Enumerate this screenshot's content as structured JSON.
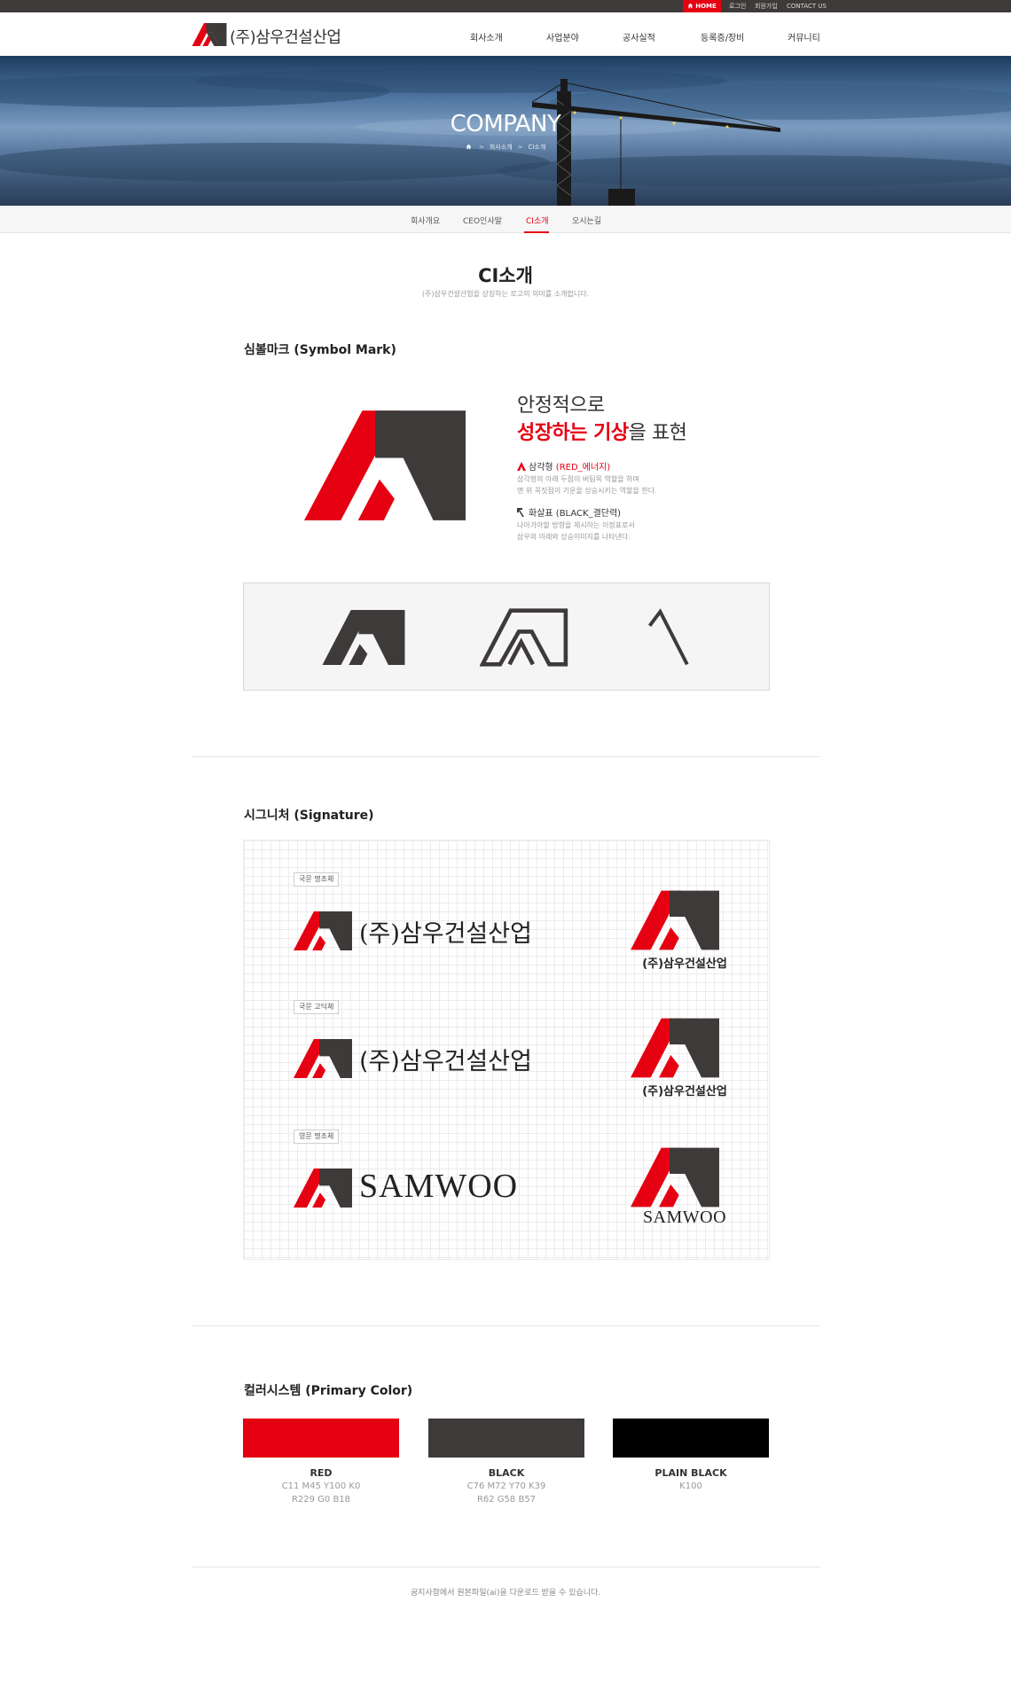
{
  "topbar": {
    "home": "HOME",
    "login": "로그인",
    "join": "회원가입",
    "contact": "CONTACT US"
  },
  "header": {
    "logo_text": "(주)삼우건설산업",
    "nav": [
      "회사소개",
      "사업분야",
      "공사실적",
      "등록증/장비",
      "커뮤니티"
    ]
  },
  "hero": {
    "title": "COMPANY",
    "breadcrumb": [
      "회사소개",
      "CI소개"
    ]
  },
  "subnav": {
    "items": [
      "회사개요",
      "CEO인사말",
      "CI소개",
      "오시는길"
    ],
    "active": "CI소개"
  },
  "page": {
    "title": "CI소개",
    "description": "(주)삼우건설산업을 상징하는 로고의 의미를 소개합니다."
  },
  "symbol": {
    "section_title": "심볼마크 (Symbol Mark)",
    "slogan_line1": "안정적으로",
    "slogan_red": "성장하는 기상",
    "slogan_rest": "을 표현",
    "items": [
      {
        "name": "삼각형",
        "tag": "(RED_에너지)",
        "lines": [
          "삼각형의 아래 두점이 버팀목 역할을 하며",
          "맨 위 꼭짓점이 기운을 상승시키는 역할을 한다."
        ]
      },
      {
        "name": "화살표",
        "tag": "(BLACK_결단력)",
        "lines": [
          "나아가야할 방향을 제시하는 이정표로서",
          "삼우의 미래와 상승이미지를 나타낸다."
        ]
      }
    ]
  },
  "signature": {
    "section_title": "시그니처 (Signature)",
    "rows": [
      {
        "tag": "국문 명조체",
        "text": "(주)삼우건설산업",
        "small": "(주)삼우건설산업"
      },
      {
        "tag": "국문 고딕체",
        "text": "(주)삼우건설산업",
        "small": "(주)삼우건설산업"
      },
      {
        "tag": "영문 명조체",
        "text": "SAMWOO",
        "small": "SAMWOO"
      }
    ]
  },
  "colors": {
    "section_title": "컬러시스템 (Primary Color)",
    "swatches": [
      {
        "name": "RED",
        "hex": "#e50012",
        "cmyk": "C11 M45 Y100 K0",
        "rgb": "R229 G0 B18"
      },
      {
        "name": "BLACK",
        "hex": "#3e3a39",
        "cmyk": "C76 M72 Y70 K39",
        "rgb": "R62 G58 B57"
      },
      {
        "name": "PLAIN BLACK",
        "hex": "#000000",
        "cmyk": "K100",
        "rgb": ""
      }
    ]
  },
  "footer_note": "공지사항에서 원본파일(ai)을 다운로드 받을 수 있습니다.",
  "theme": {
    "accent": "#e50012",
    "dark": "#3e3a39",
    "icons": [
      "home-icon",
      "logo-mark",
      "red-triangle-icon",
      "black-arrow-icon"
    ]
  }
}
